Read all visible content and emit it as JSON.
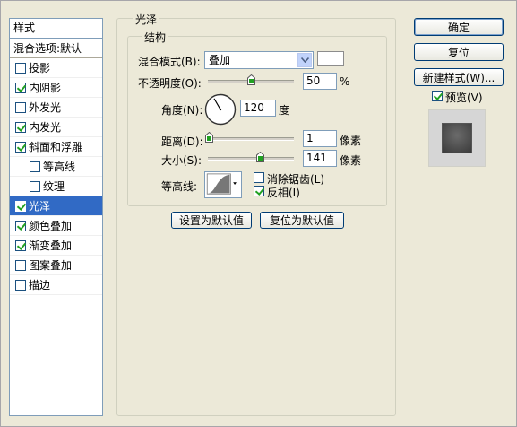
{
  "styles_panel": {
    "header": "样式",
    "blend_options": "混合选项:默认",
    "items": [
      {
        "label": "投影",
        "checked": false,
        "indent": false,
        "selected": false
      },
      {
        "label": "内阴影",
        "checked": true,
        "indent": false,
        "selected": false
      },
      {
        "label": "外发光",
        "checked": false,
        "indent": false,
        "selected": false
      },
      {
        "label": "内发光",
        "checked": true,
        "indent": false,
        "selected": false
      },
      {
        "label": "斜面和浮雕",
        "checked": true,
        "indent": false,
        "selected": false
      },
      {
        "label": "等高线",
        "checked": false,
        "indent": true,
        "selected": false
      },
      {
        "label": "纹理",
        "checked": false,
        "indent": true,
        "selected": false
      },
      {
        "label": "光泽",
        "checked": true,
        "indent": false,
        "selected": true
      },
      {
        "label": "颜色叠加",
        "checked": true,
        "indent": false,
        "selected": false
      },
      {
        "label": "渐变叠加",
        "checked": true,
        "indent": false,
        "selected": false
      },
      {
        "label": "图案叠加",
        "checked": false,
        "indent": false,
        "selected": false
      },
      {
        "label": "描边",
        "checked": false,
        "indent": false,
        "selected": false
      }
    ]
  },
  "satin": {
    "group_title": "光泽",
    "structure_title": "结构",
    "blend_mode_label": "混合模式(B):",
    "blend_mode_value": "叠加",
    "opacity_label": "不透明度(O):",
    "opacity_value": "50",
    "opacity_unit": "%",
    "opacity_fraction": 0.5,
    "angle_label": "角度(N):",
    "angle_value": "120",
    "angle_unit": "度",
    "distance_label": "距离(D):",
    "distance_value": "1",
    "distance_unit": "像素",
    "size_label": "大小(S):",
    "size_value": "141",
    "size_unit": "像素",
    "contour_label": "等高线:",
    "anti_alias_label": "消除锯齿(L)",
    "anti_alias_checked": false,
    "invert_label": "反相(I)",
    "invert_checked": true,
    "make_default": "设置为默认值",
    "reset_default": "复位为默认值"
  },
  "right_panel": {
    "ok": "确定",
    "reset": "复位",
    "new_style": "新建样式(W)...",
    "preview_label": "预览(V)",
    "preview_checked": true
  }
}
